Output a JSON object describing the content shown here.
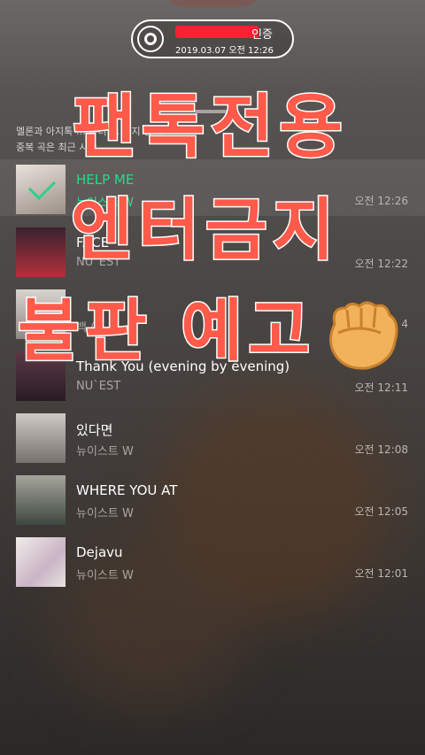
{
  "certificate": {
    "title": "인증",
    "date": "2019.03.07 오전 12:26"
  },
  "notice": {
    "line1": "멜론과 아지톡 … 부터 … 까지 등 …",
    "line2": "중복 곡은 최근 시간 …"
  },
  "songs": [
    {
      "title": "HELP ME",
      "artist": "뉴이스트 W",
      "time": "오전 12:26",
      "active": true
    },
    {
      "title": "FACE",
      "artist": "NU`EST",
      "time": "오전 12:22"
    },
    {
      "title": "",
      "artist": "백 ( )",
      "time": "4"
    },
    {
      "title": "Thank You (evening by evening)",
      "artist": "NU`EST",
      "time": "오전 12:11"
    },
    {
      "title": "있다면",
      "artist": "뉴이스트 W",
      "time": "오전 12:08"
    },
    {
      "title": "WHERE YOU AT",
      "artist": "뉴이스트 W",
      "time": "오전 12:05"
    },
    {
      "title": "Dejavu",
      "artist": "뉴이스트 W",
      "time": "오전 12:01"
    }
  ],
  "overlay": {
    "line1": "팬톡전용",
    "line2": "엔터금지",
    "line3": "불판 예고",
    "emoji": "fist-icon"
  },
  "colors": {
    "accent_green": "#1fe08a",
    "overlay_red": "#ff5a4a",
    "redaction": "#ff1e34"
  }
}
